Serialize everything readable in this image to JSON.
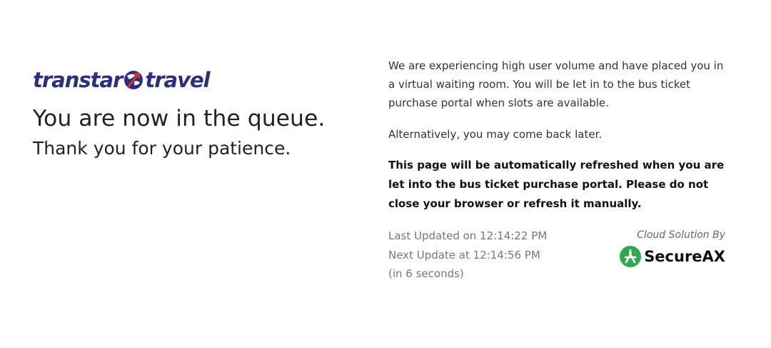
{
  "brand": {
    "logo_left": "transtar",
    "logo_right": "travel",
    "colors": {
      "navy": "#2b2f7e",
      "red": "#e42d2d",
      "green": "#2fa84f"
    }
  },
  "headline": "You are now in the queue.",
  "subheadline": "Thank you for your patience.",
  "messages": {
    "intro": "We are experiencing high user volume and have placed you in a virtual waiting room. You will be let in to the bus ticket purchase portal when slots are available.",
    "alternative": "Alternatively, you may come back later.",
    "notice": "This page will be automatically refreshed when you are let into the bus ticket purchase portal. Please do not close your browser or refresh it manually."
  },
  "status": {
    "last_updated": "Last Updated on 12:14:22 PM",
    "next_update": "Next Update at 12:14:56 PM",
    "countdown": "(in 6 seconds)"
  },
  "provider": {
    "label": "Cloud Solution By",
    "name": "SecureAX",
    "icon": "securex-logo-icon"
  }
}
